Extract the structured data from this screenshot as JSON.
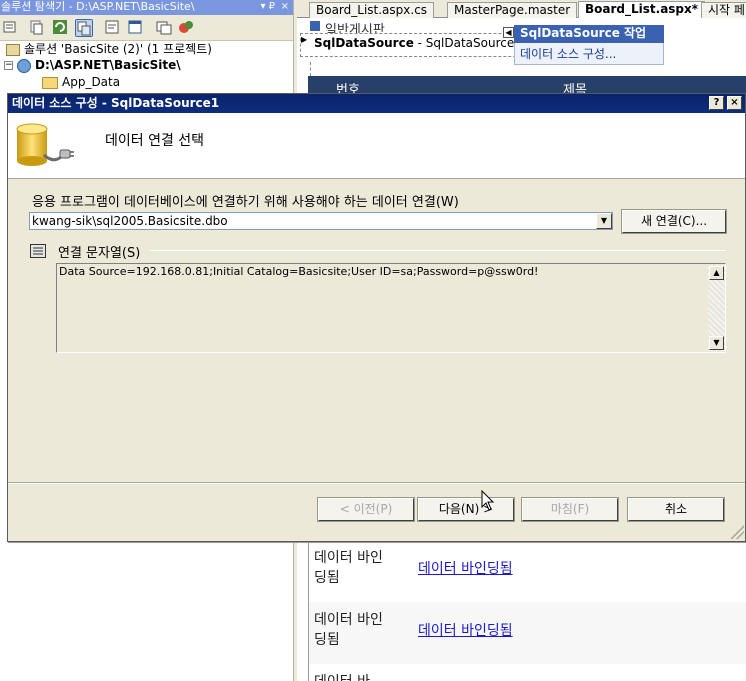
{
  "solution_explorer": {
    "title": "솔루션 탐색기 - D:\\ASP.NET\\BasicSite\\",
    "pin": "▾ ₽",
    "close": "×",
    "tree": [
      {
        "label": "솔루션 'BasicSite (2)' (1 프로젝트)"
      },
      {
        "label": "D:\\ASP.NET\\BasicSite\\"
      },
      {
        "label": "App_Data"
      }
    ]
  },
  "tabs": [
    "Board_List.aspx.cs",
    "MasterPage.master",
    "Board_List.aspx*",
    "시작 페"
  ],
  "designer": {
    "heading": "일반게시판",
    "sqldatasource_label": "SqlDataSource",
    "sqldatasource_id": " - SqlDataSource1",
    "tasks_title": "SqlDataSource 작업",
    "tasks_link": "데이터 소스 구성...",
    "grid_header": [
      "번호",
      "제목"
    ],
    "rows": [
      {
        "col1": "데이터 바인딩됨",
        "col2": "데이터 바인딩됨"
      },
      {
        "col1": "데이터 바인딩됨",
        "col2": "데이터 바인딩됨"
      },
      {
        "col1": "데이터 바"
      }
    ]
  },
  "dialog": {
    "title": "데이터 소스 구성 - SqlDataSource1",
    "help_btn": "?",
    "close_btn": "×",
    "header_title": "데이터 연결 선택",
    "connection_label": "응용 프로그램이 데이터베이스에 연결하기 위해 사용해야 하는 데이터 연결(W)",
    "connection_value": "kwang-sik\\sql2005.Basicsite.dbo",
    "new_connection_btn": "새 연결(C)...",
    "connstring_label": "연결 문자열(S)",
    "connstring_value": "Data Source=192.168.0.81;Initial Catalog=Basicsite;User ID=sa;Password=p@ssw0rd!",
    "buttons": {
      "prev": "< 이전(P)",
      "next": "다음(N) >",
      "finish": "마침(F)",
      "cancel": "취소"
    }
  },
  "colors": {
    "title_bar": "#0a246a",
    "dialog_bg": "#ece9d8",
    "grid_header": "#27406a",
    "link": "#1a1acc"
  }
}
